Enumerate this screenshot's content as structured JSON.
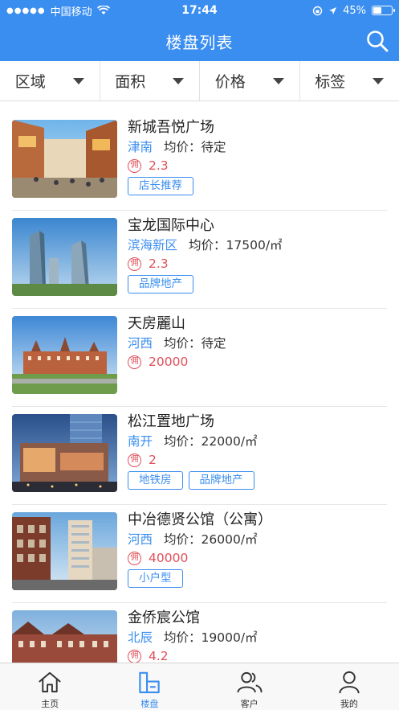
{
  "status_bar": {
    "carrier": "中国移动",
    "time": "17:44",
    "battery": "45%",
    "battery_level": 0.45
  },
  "nav": {
    "title": "楼盘列表",
    "search_icon": "search-icon"
  },
  "filters": [
    {
      "label": "区域"
    },
    {
      "label": "面积"
    },
    {
      "label": "价格"
    },
    {
      "label": "标签"
    }
  ],
  "listings": [
    {
      "name": "新城吾悦广场",
      "district": "津南",
      "price": "均价：待定",
      "commission": "2.3",
      "commission_badge": "佣",
      "tags": [
        "店长推荐"
      ]
    },
    {
      "name": "宝龙国际中心",
      "district": "滨海新区",
      "price": "均价：17500/㎡",
      "commission": "2.3",
      "commission_badge": "佣",
      "tags": [
        "品牌地产"
      ]
    },
    {
      "name": "天房麗山",
      "district": "河西",
      "price": "均价：待定",
      "commission": "20000",
      "commission_badge": "佣",
      "tags": []
    },
    {
      "name": "松江置地广场",
      "district": "南开",
      "price": "均价：22000/㎡",
      "commission": "2",
      "commission_badge": "佣",
      "tags": [
        "地铁房",
        "品牌地产"
      ]
    },
    {
      "name": "中冶德贤公馆（公寓）",
      "district": "河西",
      "price": "均价：26000/㎡",
      "commission": "40000",
      "commission_badge": "佣",
      "tags": [
        "小户型"
      ]
    },
    {
      "name": "金侨宸公馆",
      "district": "北辰",
      "price": "均价：19000/㎡",
      "commission": "4.2",
      "commission_badge": "佣",
      "tags": []
    }
  ],
  "tabbar": [
    {
      "label": "主页",
      "icon": "home-icon",
      "active": false
    },
    {
      "label": "楼盘",
      "icon": "building-icon",
      "active": true
    },
    {
      "label": "客户",
      "icon": "customers-icon",
      "active": false
    },
    {
      "label": "我的",
      "icon": "profile-icon",
      "active": false
    }
  ],
  "colors": {
    "accent": "#3a8ef0",
    "commission": "#e0505a"
  }
}
